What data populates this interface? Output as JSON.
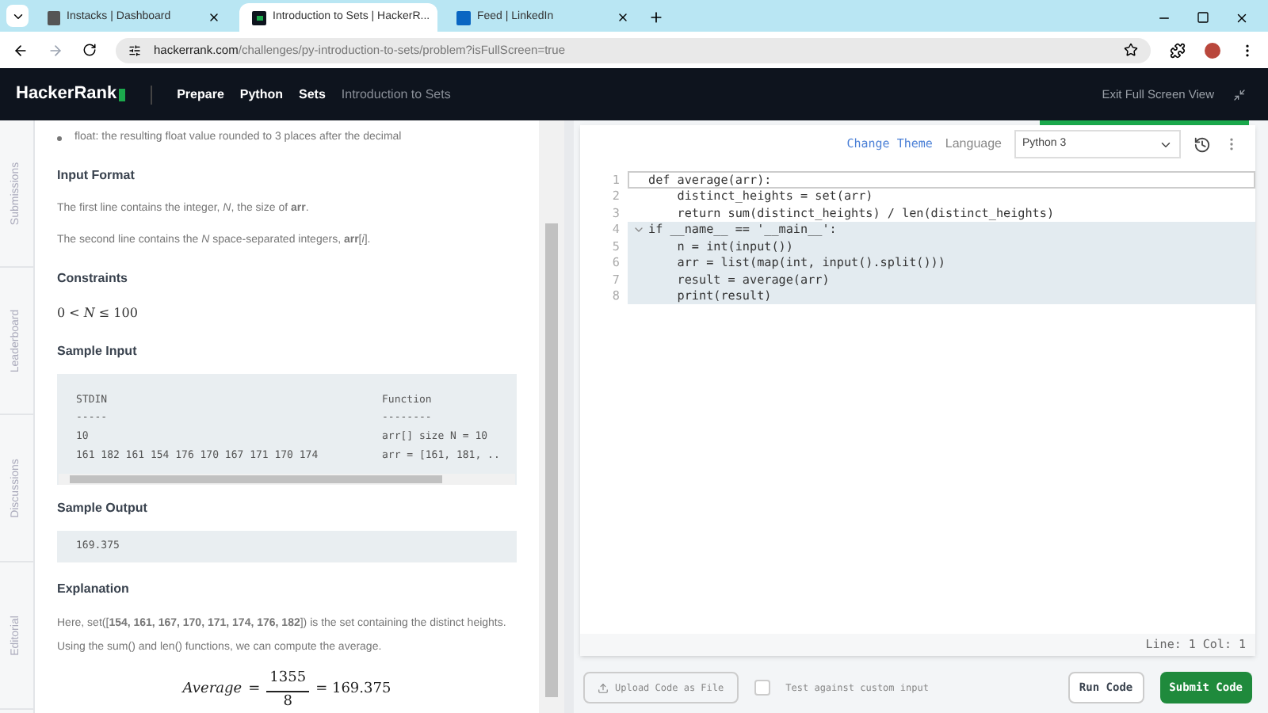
{
  "browser": {
    "tabs": [
      {
        "title": "Instacks | Dashboard",
        "selected": false,
        "kind": "dashboard"
      },
      {
        "title": "Introduction to Sets | HackerR...",
        "selected": true,
        "kind": "hackerrank"
      },
      {
        "title": "Feed | LinkedIn",
        "selected": false,
        "kind": "linkedin"
      }
    ],
    "url": {
      "host": "hackerrank.com",
      "path": "/challenges/py-introduction-to-sets/problem?isFullScreen=true"
    }
  },
  "header": {
    "logo": "HackerRank",
    "breadcrumbs": [
      {
        "label": "Prepare",
        "selected": false
      },
      {
        "label": "Python",
        "selected": false
      },
      {
        "label": "Sets",
        "selected": false
      },
      {
        "label": "Introduction to Sets",
        "selected": true
      }
    ],
    "exit": "Exit Full Screen View"
  },
  "side_tabs": [
    "Submissions",
    "Leaderboard",
    "Discussions",
    "Editorial"
  ],
  "problem": {
    "return_item": "float: the resulting float value rounded to 3 places after the decimal",
    "input_format": {
      "heading": "Input Format",
      "lines": [
        "The first line contains the integer, *N*, the size of **arr**.",
        "The second line contains the *N* space-separated integers, **arr**[*i*]."
      ]
    },
    "constraints": {
      "heading": "Constraints",
      "formula": "0 < *N* ≤ 100"
    },
    "sample_input": {
      "heading": "Sample Input",
      "rows": [
        [
          "STDIN",
          "Function"
        ],
        [
          "-----",
          "--------"
        ],
        [
          "10",
          "arr[] size N = 10"
        ],
        [
          "161 182 161 154 176 170 167 171 170 174",
          "arr = [161, 181, .."
        ]
      ]
    },
    "sample_output": {
      "heading": "Sample Output",
      "text": "169.375"
    },
    "explanation": {
      "heading": "Explanation",
      "text": "Here, set([**154, 161, 167, 170, 171, 174, 176, 182**]) is the set containing the distinct heights. Using the sum() and len() functions, we can compute the average.",
      "formula": {
        "lhs": "Average",
        "equals": "=",
        "numerator": "1355",
        "denominator": "8",
        "rhs": "= 169.375"
      }
    }
  },
  "editor": {
    "change_theme": "Change Theme",
    "language_label": "Language",
    "language": "Python 3",
    "lines": [
      {
        "number": "1",
        "code": "def average(arr):",
        "highlighted": false,
        "current": true,
        "foldable": false
      },
      {
        "number": "2",
        "code": "    distinct_heights = set(arr)",
        "highlighted": false,
        "current": false,
        "foldable": false
      },
      {
        "number": "3",
        "code": "    return sum(distinct_heights) / len(distinct_heights)",
        "highlighted": false,
        "current": false,
        "foldable": false
      },
      {
        "number": "4",
        "code": "if __name__ == '__main__':",
        "highlighted": true,
        "current": false,
        "foldable": true
      },
      {
        "number": "5",
        "code": "    n = int(input())",
        "highlighted": true,
        "current": false,
        "foldable": false
      },
      {
        "number": "6",
        "code": "    arr = list(map(int, input().split()))",
        "highlighted": true,
        "current": false,
        "foldable": false
      },
      {
        "number": "7",
        "code": "    result = average(arr)",
        "highlighted": true,
        "current": false,
        "foldable": false
      },
      {
        "number": "8",
        "code": "    print(result)",
        "highlighted": true,
        "current": false,
        "foldable": false
      }
    ],
    "position": "Line: 1 Col: 1"
  },
  "actions": {
    "upload": "Upload Code as File",
    "custom_input": {
      "label": "Test against custom input",
      "checked": false
    },
    "run": "Run Code",
    "submit": "Submit Code"
  }
}
